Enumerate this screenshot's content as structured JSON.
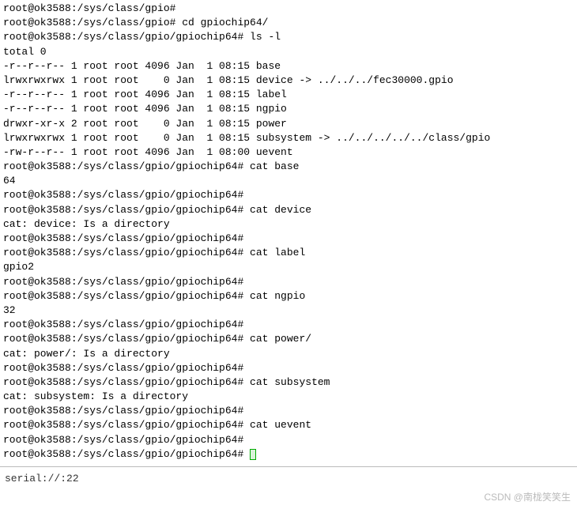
{
  "lines": [
    {
      "prompt": "root@ok3588:/sys/class/gpio#",
      "cmd": ""
    },
    {
      "prompt": "root@ok3588:/sys/class/gpio#",
      "cmd": " cd gpiochip64/"
    },
    {
      "prompt": "root@ok3588:/sys/class/gpio/gpiochip64#",
      "cmd": " ls -l"
    },
    {
      "out": "total 0"
    },
    {
      "out": "-r--r--r-- 1 root root 4096 Jan  1 08:15 base"
    },
    {
      "out": "lrwxrwxrwx 1 root root    0 Jan  1 08:15 device -> ../../../fec30000.gpio"
    },
    {
      "out": "-r--r--r-- 1 root root 4096 Jan  1 08:15 label"
    },
    {
      "out": "-r--r--r-- 1 root root 4096 Jan  1 08:15 ngpio"
    },
    {
      "out": "drwxr-xr-x 2 root root    0 Jan  1 08:15 power"
    },
    {
      "out": "lrwxrwxrwx 1 root root    0 Jan  1 08:15 subsystem -> ../../../../../class/gpio"
    },
    {
      "out": "-rw-r--r-- 1 root root 4096 Jan  1 08:00 uevent"
    },
    {
      "prompt": "root@ok3588:/sys/class/gpio/gpiochip64#",
      "cmd": " cat base"
    },
    {
      "out": "64"
    },
    {
      "prompt": "root@ok3588:/sys/class/gpio/gpiochip64#",
      "cmd": ""
    },
    {
      "prompt": "root@ok3588:/sys/class/gpio/gpiochip64#",
      "cmd": " cat device"
    },
    {
      "out": "cat: device: Is a directory"
    },
    {
      "prompt": "root@ok3588:/sys/class/gpio/gpiochip64#",
      "cmd": ""
    },
    {
      "prompt": "root@ok3588:/sys/class/gpio/gpiochip64#",
      "cmd": " cat label"
    },
    {
      "out": "gpio2"
    },
    {
      "prompt": "root@ok3588:/sys/class/gpio/gpiochip64#",
      "cmd": ""
    },
    {
      "prompt": "root@ok3588:/sys/class/gpio/gpiochip64#",
      "cmd": " cat ngpio"
    },
    {
      "out": "32"
    },
    {
      "prompt": "root@ok3588:/sys/class/gpio/gpiochip64#",
      "cmd": ""
    },
    {
      "prompt": "root@ok3588:/sys/class/gpio/gpiochip64#",
      "cmd": " cat power/"
    },
    {
      "out": "cat: power/: Is a directory"
    },
    {
      "prompt": "root@ok3588:/sys/class/gpio/gpiochip64#",
      "cmd": ""
    },
    {
      "prompt": "root@ok3588:/sys/class/gpio/gpiochip64#",
      "cmd": " cat subsystem"
    },
    {
      "out": "cat: subsystem: Is a directory"
    },
    {
      "prompt": "root@ok3588:/sys/class/gpio/gpiochip64#",
      "cmd": ""
    },
    {
      "prompt": "root@ok3588:/sys/class/gpio/gpiochip64#",
      "cmd": " cat uevent"
    },
    {
      "prompt": "root@ok3588:/sys/class/gpio/gpiochip64#",
      "cmd": ""
    },
    {
      "prompt": "root@ok3588:/sys/class/gpio/gpiochip64#",
      "cmd": " ",
      "cursor": true
    }
  ],
  "status": "serial://:22",
  "watermark": "CSDN @南栊笑笑生"
}
